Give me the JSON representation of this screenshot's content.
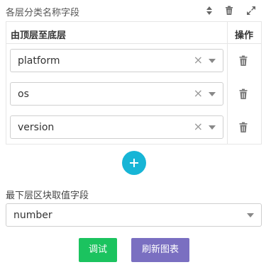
{
  "header": {
    "title": "各层分类名称字段"
  },
  "table": {
    "col_levels": "由顶层至底层",
    "col_ops": "操作",
    "rows": [
      {
        "value": "platform"
      },
      {
        "value": "os"
      },
      {
        "value": "version"
      }
    ]
  },
  "clear_glyph": "×",
  "bottom_field": {
    "label": "最下层区块取值字段",
    "value": "number"
  },
  "buttons": {
    "debug": "调试",
    "refresh": "刷新图表"
  },
  "colors": {
    "add": "#17b5d6",
    "debug": "#1bc35f",
    "refresh": "#7a6fc1"
  },
  "icons": [
    "sort-icon",
    "trash-icon",
    "expand-icon",
    "add-icon"
  ]
}
